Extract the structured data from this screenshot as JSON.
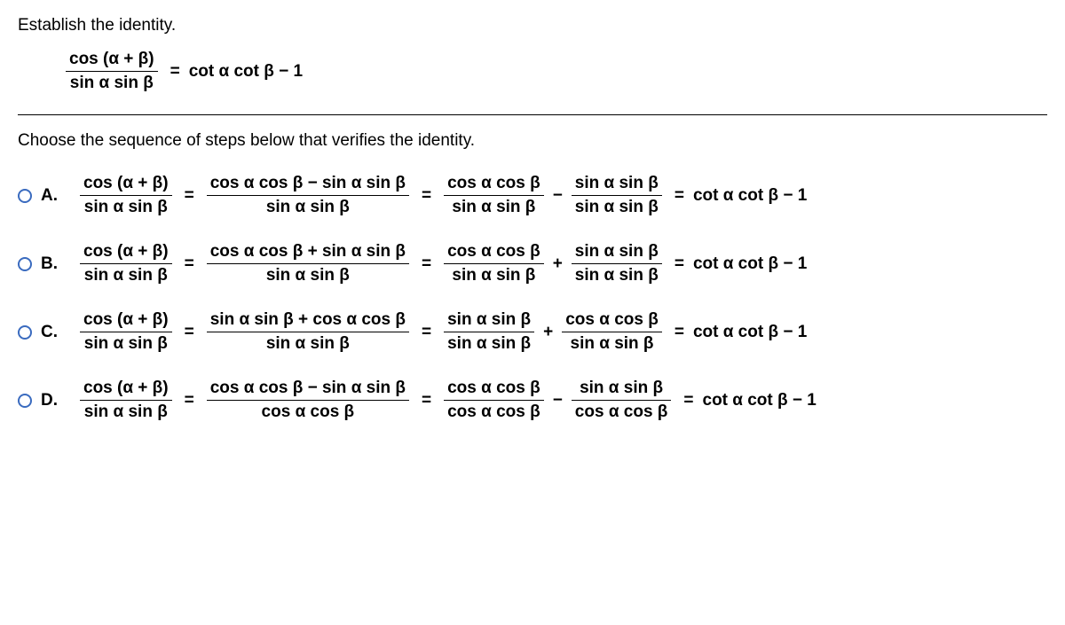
{
  "prompt": "Establish the identity.",
  "identity": {
    "lhs_num": "cos (α + β)",
    "lhs_den": "sin α sin β",
    "eq": "=",
    "rhs": "cot α cot β − 1"
  },
  "instruction": "Choose the sequence of steps below that verifies the identity.",
  "options": [
    {
      "letter": "A.",
      "f1_num": "cos (α + β)",
      "f1_den": "sin α sin β",
      "f2_num": "cos α cos β − sin α sin β",
      "f2_den": "sin α sin β",
      "f3a_num": "cos α cos β",
      "f3a_den": "sin α sin β",
      "mid_op": "−",
      "f3b_num": "sin α sin β",
      "f3b_den": "sin α sin β",
      "result": "cot α cot β − 1"
    },
    {
      "letter": "B.",
      "f1_num": "cos (α + β)",
      "f1_den": "sin α sin β",
      "f2_num": "cos α cos β + sin α sin β",
      "f2_den": "sin α sin β",
      "f3a_num": "cos α cos β",
      "f3a_den": "sin α sin β",
      "mid_op": "+",
      "f3b_num": "sin α sin β",
      "f3b_den": "sin α sin β",
      "result": "cot α cot β − 1"
    },
    {
      "letter": "C.",
      "f1_num": "cos (α + β)",
      "f1_den": "sin α sin β",
      "f2_num": "sin α sin β + cos α cos β",
      "f2_den": "sin α sin β",
      "f3a_num": "sin α sin β",
      "f3a_den": "sin α sin β",
      "mid_op": "+",
      "f3b_num": "cos α cos β",
      "f3b_den": "sin α sin β",
      "result": "cot α cot β − 1"
    },
    {
      "letter": "D.",
      "f1_num": "cos (α + β)",
      "f1_den": "sin α sin β",
      "f2_num": "cos α cos β − sin α sin β",
      "f2_den": "cos α cos β",
      "f3a_num": "cos α cos β",
      "f3a_den": "cos α cos β",
      "mid_op": "−",
      "f3b_num": "sin α sin β",
      "f3b_den": "cos α cos β",
      "result": "cot α cot β − 1"
    }
  ],
  "eq_sym": "="
}
